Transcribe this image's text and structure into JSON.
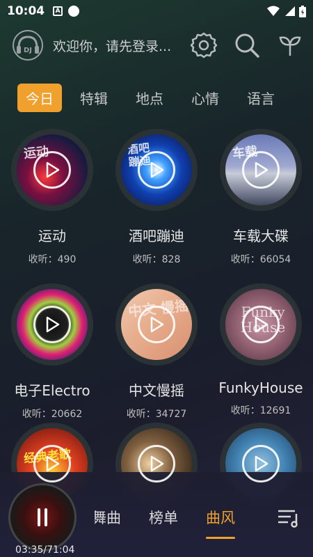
{
  "status": {
    "time": "10:04"
  },
  "header": {
    "welcome": "欢迎你，请先登录..."
  },
  "tabs": [
    {
      "label": "今日",
      "active": true
    },
    {
      "label": "特辑",
      "active": false
    },
    {
      "label": "地点",
      "active": false
    },
    {
      "label": "心情",
      "active": false
    },
    {
      "label": "语言",
      "active": false
    }
  ],
  "cards": [
    {
      "title": "运动",
      "count": "收听：490",
      "disc_text": "运动"
    },
    {
      "title": "酒吧蹦迪",
      "count": "收听：828",
      "disc_text": "酒吧\n蹦迪"
    },
    {
      "title": "车载大碟",
      "count": "收听：66054",
      "disc_text": "车载"
    },
    {
      "title": "电子Electro",
      "count": "收听：20662",
      "disc_text": ""
    },
    {
      "title": "中文慢摇",
      "count": "收听：34727",
      "disc_text": "中文 慢摇"
    },
    {
      "title": "FunkyHouse",
      "count": "收听：12691",
      "disc_text": "Funky House"
    },
    {
      "title": "",
      "count": "",
      "disc_text": "经典老歌"
    },
    {
      "title": "",
      "count": "",
      "disc_text": ""
    },
    {
      "title": "",
      "count": "",
      "disc_text": ""
    }
  ],
  "player": {
    "time": "03:35/71:04"
  },
  "bottom_nav": [
    {
      "label": "舞曲",
      "active": false
    },
    {
      "label": "榜单",
      "active": false
    },
    {
      "label": "曲风",
      "active": true
    }
  ],
  "colors": {
    "accent": "#f0a02c"
  }
}
